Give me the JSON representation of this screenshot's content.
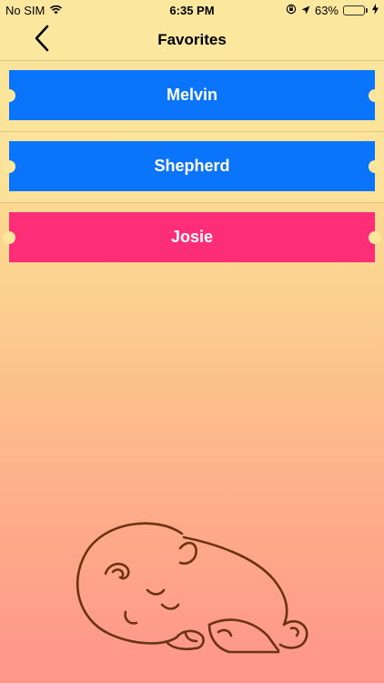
{
  "status_bar": {
    "carrier": "No SIM",
    "time": "6:35 PM",
    "battery_percent": "63%",
    "battery_level": 0.63,
    "icons": [
      "wifi-icon",
      "orientation-lock-icon",
      "location-icon",
      "battery-icon",
      "charging-bolt-icon"
    ]
  },
  "nav": {
    "title": "Favorites",
    "back_icon": "chevron-left-icon"
  },
  "favorites": [
    {
      "name": "Melvin",
      "color": "#0a74fb"
    },
    {
      "name": "Shepherd",
      "color": "#0a74fb"
    },
    {
      "name": "Josie",
      "color": "#fd2d78"
    }
  ],
  "colors": {
    "nav_background": "#fbe89e",
    "gradient_top": "#fbe59a",
    "gradient_bottom": "#ff958a",
    "illustration_stroke": "#6b3310"
  },
  "illustration": "sleeping-baby-icon"
}
